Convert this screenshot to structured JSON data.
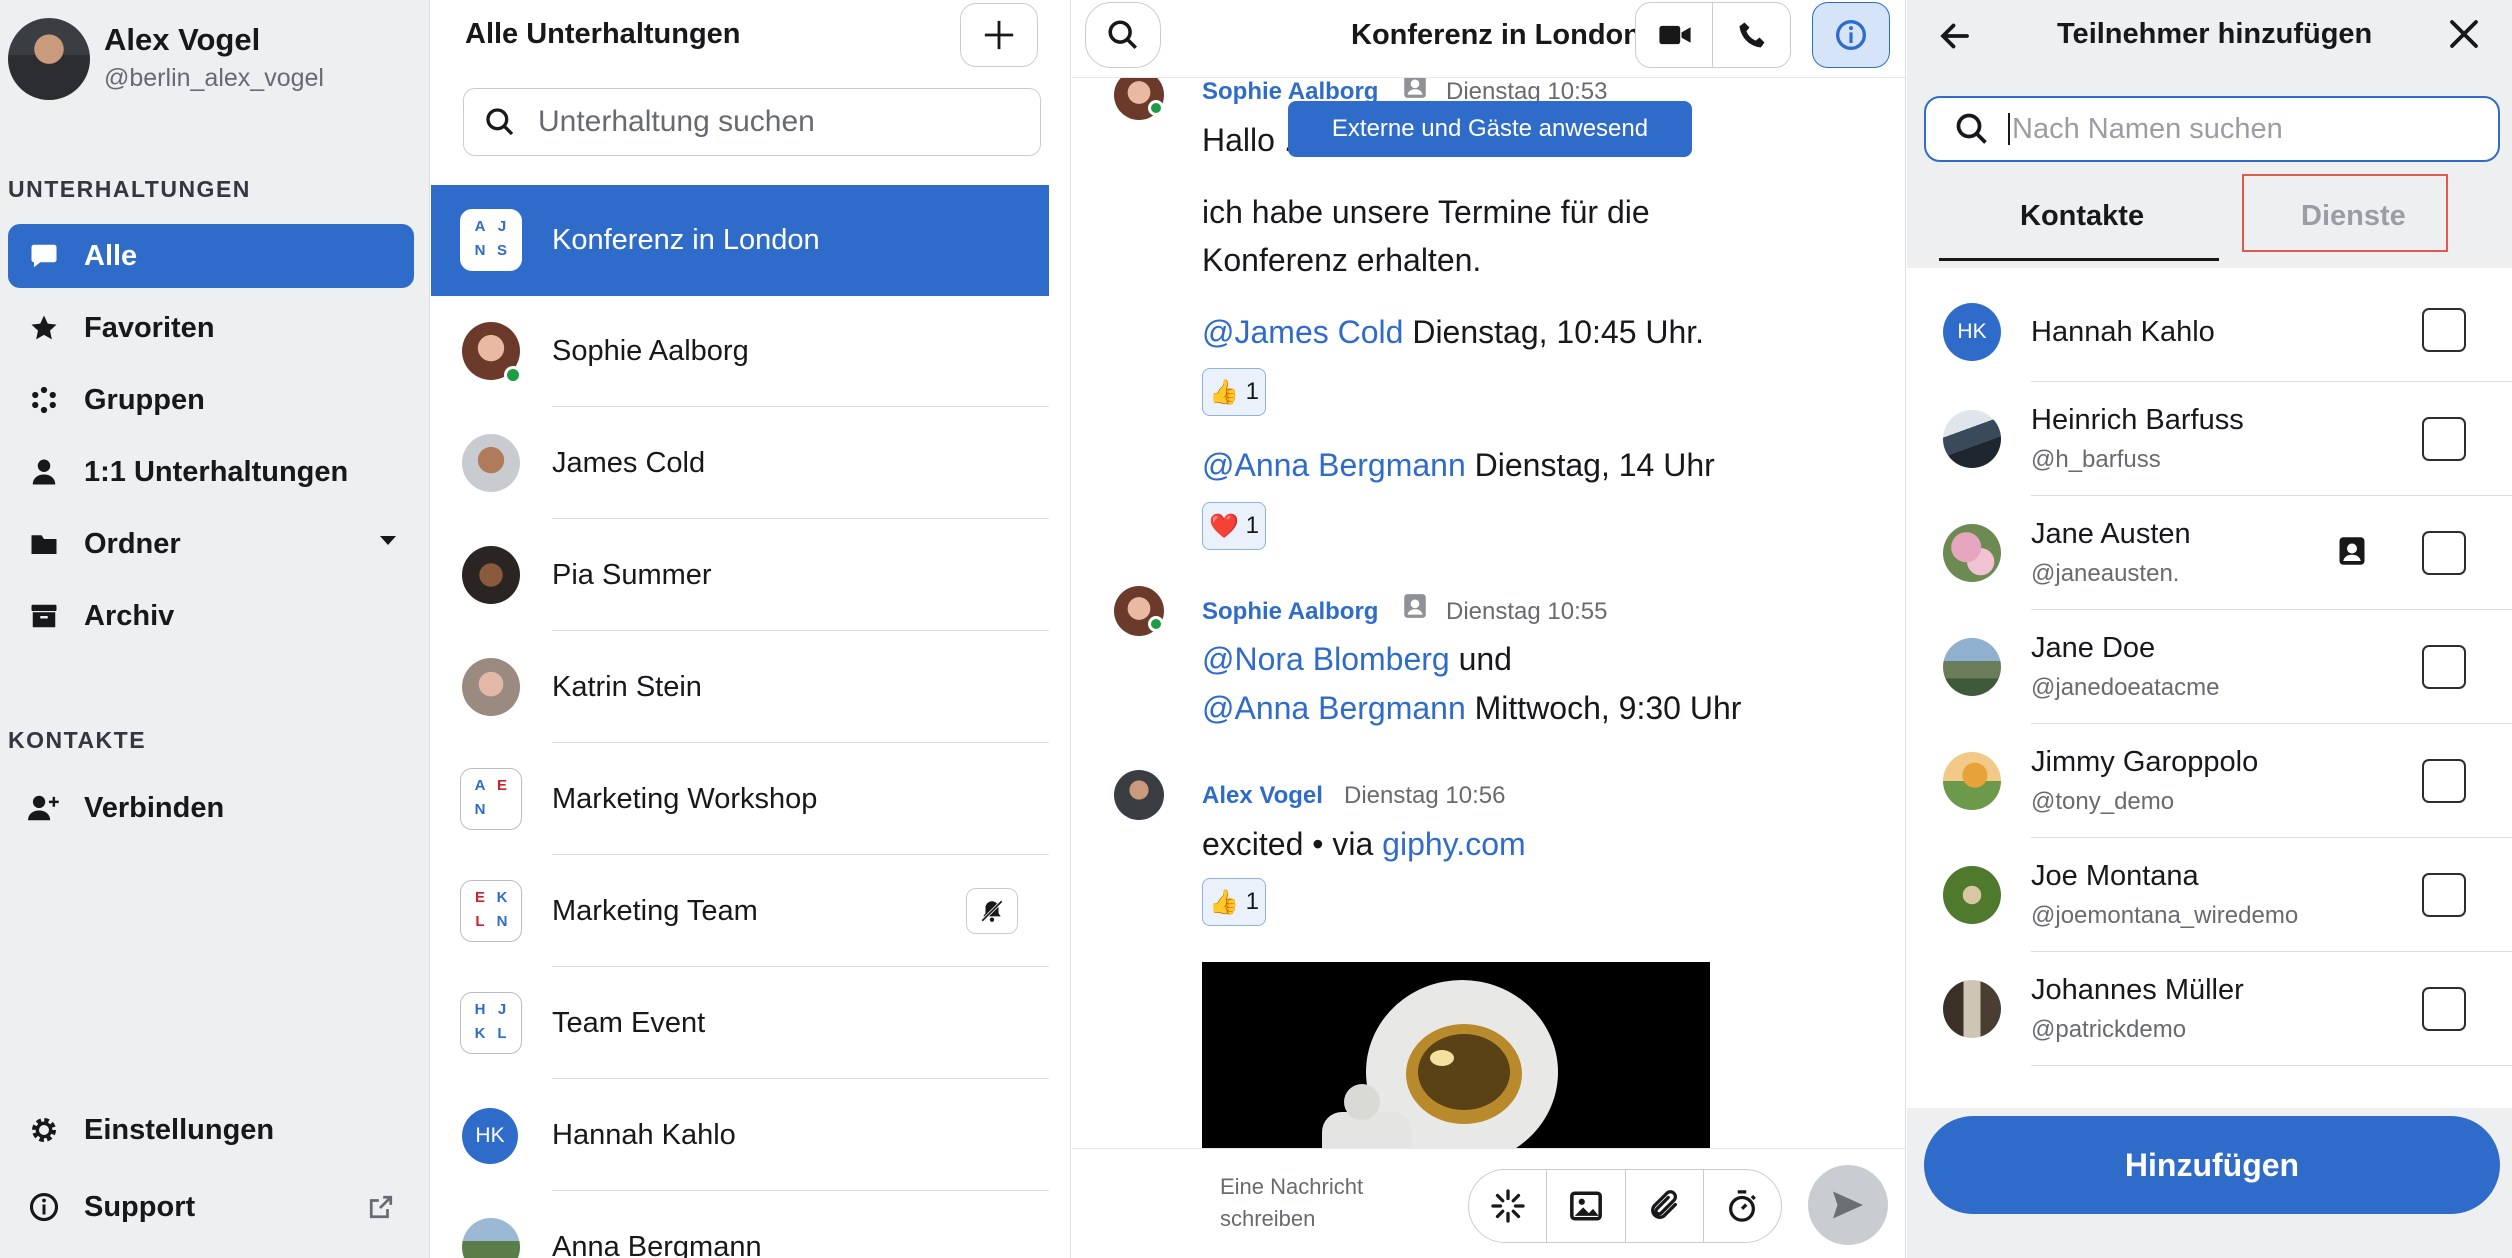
{
  "user": {
    "name": "Alex Vogel",
    "handle": "@berlin_alex_vogel"
  },
  "sidebar": {
    "section_conversations": "UNTERHALTUNGEN",
    "nav": [
      {
        "label": "Alle",
        "icon": "chat-bubble-icon",
        "active": true
      },
      {
        "label": "Favoriten",
        "icon": "star-icon"
      },
      {
        "label": "Gruppen",
        "icon": "groups-icon"
      },
      {
        "label": "1:1 Unterhaltungen",
        "icon": "person-icon"
      },
      {
        "label": "Ordner",
        "icon": "folder-icon"
      },
      {
        "label": "Archiv",
        "icon": "archive-icon"
      }
    ],
    "section_contacts": "KONTAKTE",
    "connect": "Verbinden",
    "settings": "Einstellungen",
    "support": "Support"
  },
  "conversations": {
    "title": "Alle Unterhaltungen",
    "search_placeholder": "Unterhaltung suchen",
    "items": [
      {
        "name": "Konferenz in London",
        "initials": [
          "A",
          "J",
          "N",
          "S"
        ],
        "active": true
      },
      {
        "name": "Sophie Aalborg",
        "online": true
      },
      {
        "name": "James Cold"
      },
      {
        "name": "Pia Summer"
      },
      {
        "name": "Katrin Stein"
      },
      {
        "name": "Marketing Workshop",
        "initials": [
          "A",
          "E",
          "N",
          ""
        ]
      },
      {
        "name": "Marketing Team",
        "initials": [
          "E",
          "K",
          "L",
          "N"
        ],
        "muted": true
      },
      {
        "name": "Team Event",
        "initials": [
          "H",
          "J",
          "K",
          "L"
        ]
      },
      {
        "name": "Hannah Kahlo",
        "avatar_initials": "HK"
      },
      {
        "name": "Anna Bergmann"
      }
    ]
  },
  "chat": {
    "title": "Konferenz in London",
    "tooltip": "Externe und Gäste anwesend",
    "msg1": {
      "sender": "Sophie Aalborg",
      "time": "Dienstag 10:53",
      "line1": "Hallo ...",
      "line2a": "ich habe unsere Termine für die",
      "line2b": "Konferenz erhalten.",
      "mention1": "@James Cold",
      "text1": " Dienstag, 10:45 Uhr.",
      "react1_emoji": "👍",
      "react1_count": "1",
      "mention2": "@Anna Bergmann",
      "text2": " Dienstag, 14 Uhr",
      "react2_emoji": "❤️",
      "react2_count": "1"
    },
    "msg2": {
      "sender": "Sophie Aalborg",
      "time": "Dienstag 10:55",
      "mention1": "@Nora Blomberg",
      "text1": " und",
      "mention2": "@Anna Bergmann",
      "text2": " Mittwoch, 9:30 Uhr"
    },
    "msg3": {
      "sender": "Alex Vogel",
      "time": "Dienstag 10:56",
      "text": "excited • via ",
      "link": "giphy.com",
      "react_emoji": "👍",
      "react_count": "1"
    },
    "composer_placeholder": "Eine Nachricht schreiben"
  },
  "panel": {
    "title": "Teilnehmer hinzufügen",
    "search_placeholder": "Nach Namen suchen",
    "tab_contacts": "Kontakte",
    "tab_services": "Dienste",
    "contacts": [
      {
        "name": "Hannah Kahlo",
        "handle": "",
        "avatar_initials": "HK"
      },
      {
        "name": "Heinrich Barfuss",
        "handle": "@h_barfuss"
      },
      {
        "name": "Jane Austen",
        "handle": "@janeausten.",
        "badge": "contact-card-icon"
      },
      {
        "name": "Jane Doe",
        "handle": "@janedoeatacme"
      },
      {
        "name": "Jimmy Garoppolo",
        "handle": "@tony_demo"
      },
      {
        "name": "Joe Montana",
        "handle": "@joemontana_wiredemo"
      },
      {
        "name": "Johannes Müller",
        "handle": "@patrickdemo"
      }
    ],
    "add_button": "Hinzufügen"
  },
  "colors": {
    "accent": "#2f6cc9",
    "online": "#1d9c45",
    "highlight_box": "#e05a4e"
  }
}
